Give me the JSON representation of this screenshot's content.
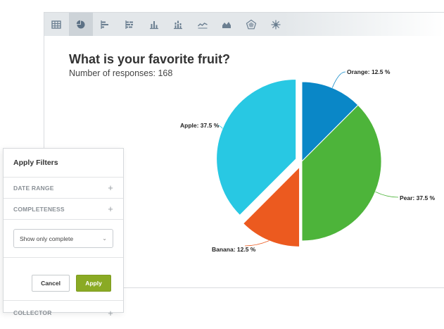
{
  "toolbar": {
    "active_index": 1,
    "buttons": [
      {
        "icon": "table-icon"
      },
      {
        "icon": "pie-chart-icon"
      },
      {
        "icon": "horizontal-bar-icon"
      },
      {
        "icon": "stacked-horizontal-bar-icon"
      },
      {
        "icon": "vertical-bar-icon"
      },
      {
        "icon": "stacked-vertical-bar-icon"
      },
      {
        "icon": "line-chart-icon"
      },
      {
        "icon": "area-chart-icon"
      },
      {
        "icon": "radar-chart-icon"
      },
      {
        "icon": "spider-chart-icon"
      }
    ]
  },
  "chart_data": {
    "type": "pie",
    "title": "What is your favorite fruit?",
    "subtitle": "Number of responses: 168",
    "slices": [
      {
        "name": "Orange",
        "value": 12.5,
        "label": "Orange: 12.5 %",
        "color": "#0a87c7",
        "exploded": false
      },
      {
        "name": "Pear",
        "value": 37.5,
        "label": "Pear: 37.5 %",
        "color": "#4db43a",
        "exploded": false
      },
      {
        "name": "Banana",
        "value": 12.5,
        "label": "Banana: 12.5 %",
        "color": "#ec5a1f",
        "exploded": true
      },
      {
        "name": "Apple",
        "value": 37.5,
        "label": "Apple: 37.5 %",
        "color": "#28c8e3",
        "exploded": true
      }
    ]
  },
  "filters": {
    "title": "Apply Filters",
    "date_range": "DATE RANGE",
    "completeness": "COMPLETENESS",
    "select_value": "Show only complete",
    "cancel_label": "Cancel",
    "apply_label": "Apply",
    "collector": "COLLECTOR",
    "accent": "#8aaa24"
  }
}
